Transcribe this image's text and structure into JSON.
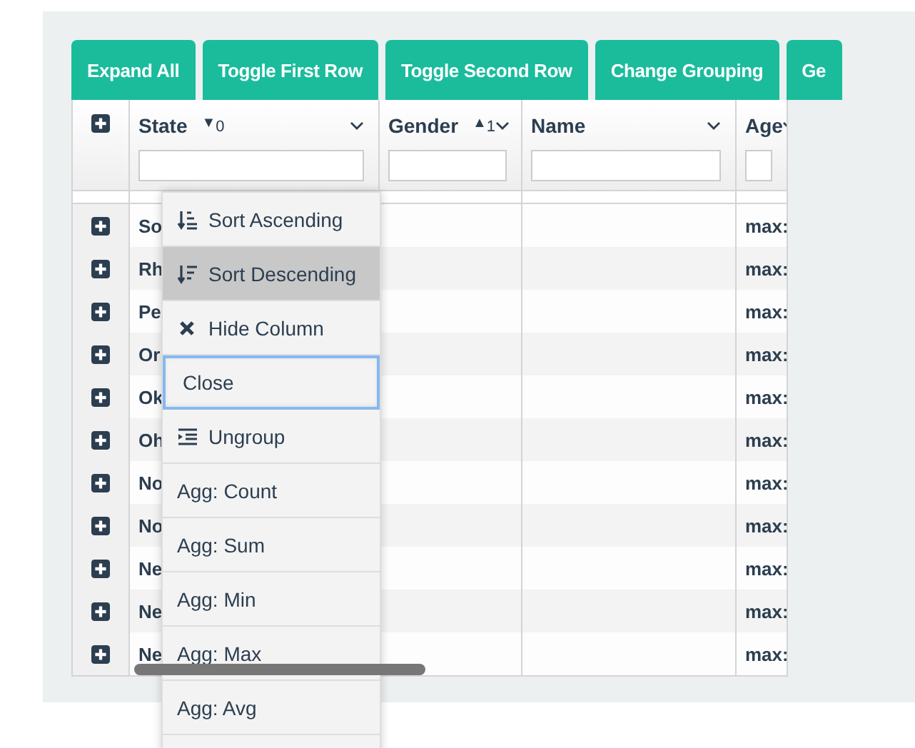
{
  "buttons": [
    "Expand All",
    "Toggle First Row",
    "Toggle Second Row",
    "Change Grouping",
    "Ge"
  ],
  "columns": [
    {
      "label": "State",
      "sort_icon": "▼",
      "sort_priority": "0"
    },
    {
      "label": "Gender",
      "sort_icon": "▲",
      "sort_priority": "1"
    },
    {
      "label": "Name"
    },
    {
      "label": "Age"
    }
  ],
  "rows": [
    {
      "state": "So",
      "age": "max:"
    },
    {
      "state": "Rh",
      "age": "max:"
    },
    {
      "state": "Pe",
      "age": "max:"
    },
    {
      "state": "Or",
      "age": "max:"
    },
    {
      "state": "Ok",
      "age": "max:"
    },
    {
      "state": "Oh",
      "age": "max:"
    },
    {
      "state": "No",
      "age": "max:"
    },
    {
      "state": "No",
      "age": "max:"
    },
    {
      "state": "Ne",
      "age": "max:"
    },
    {
      "state": "Ne",
      "age": "max:"
    },
    {
      "state": "Ne",
      "age": "max:"
    }
  ],
  "column_menu": [
    {
      "label": "Sort Ascending",
      "kind": "sort-asc",
      "selected": false,
      "focused": false
    },
    {
      "label": "Sort Descending",
      "kind": "sort-desc",
      "selected": true,
      "focused": false
    },
    {
      "label": "Hide Column",
      "kind": "hide",
      "selected": false,
      "focused": false
    },
    {
      "label": "Close",
      "kind": "plain",
      "selected": false,
      "focused": true
    },
    {
      "label": "Ungroup",
      "kind": "ungroup",
      "selected": false,
      "focused": false
    },
    {
      "label": "Agg: Count",
      "kind": "plain",
      "selected": false,
      "focused": false
    },
    {
      "label": "Agg: Sum",
      "kind": "plain",
      "selected": false,
      "focused": false
    },
    {
      "label": "Agg: Min",
      "kind": "plain",
      "selected": false,
      "focused": false
    },
    {
      "label": "Agg: Max",
      "kind": "plain",
      "selected": false,
      "focused": false
    },
    {
      "label": "Agg: Avg",
      "kind": "plain",
      "selected": false,
      "focused": false
    }
  ]
}
